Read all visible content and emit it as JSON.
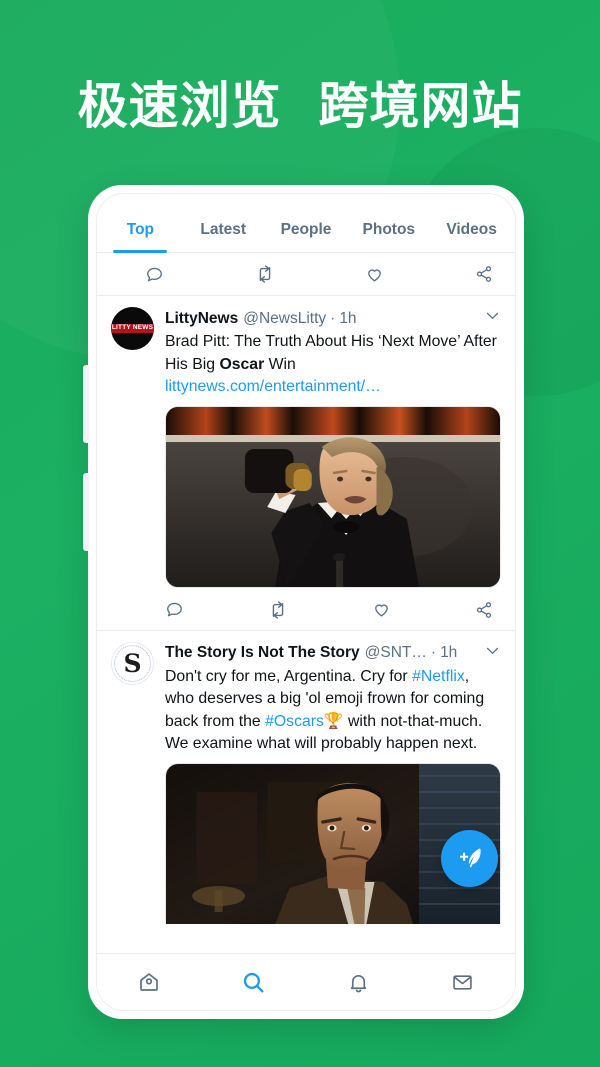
{
  "headline": "极速浏览  跨境网站",
  "theme": {
    "background_green": "#1bb062",
    "accent_blue": "#1d9bf0",
    "text_dark": "#0f1419",
    "text_muted": "#5b7083"
  },
  "phone": {
    "tabs": [
      {
        "label": "Top",
        "active": true
      },
      {
        "label": "Latest",
        "active": false
      },
      {
        "label": "People",
        "active": false
      },
      {
        "label": "Photos",
        "active": false
      },
      {
        "label": "Videos",
        "active": false
      }
    ],
    "top_actions": [
      {
        "icon": "reply-icon"
      },
      {
        "icon": "retweet-icon"
      },
      {
        "icon": "like-icon"
      },
      {
        "icon": "share-icon"
      }
    ],
    "tweets": [
      {
        "avatar_text": "LITTY NEWS",
        "name": "LittyNews",
        "handle": "@NewsLitty",
        "dot": "·",
        "time": "1h",
        "text_part1": "Brad Pitt: The Truth About His ‘Next Move’ After His Big ",
        "text_bold": "Oscar",
        "text_part2": " Win",
        "link": "littynews.com/entertainment/…",
        "media_alt": "Man in tuxedo holding award on stage",
        "actions": [
          {
            "icon": "reply-icon"
          },
          {
            "icon": "retweet-icon"
          },
          {
            "icon": "like-icon"
          },
          {
            "icon": "share-icon"
          }
        ]
      },
      {
        "avatar_text": "S",
        "name": "The Story Is Not The Story",
        "handle": "@SNT…",
        "dot": "·",
        "time": "1h",
        "text_part1": "Don't cry for me, Argentina. Cry for ",
        "tag1": "#Netflix",
        "text_part2": ", who deserves a big 'ol emoji frown for coming back from the ",
        "tag2": "#Oscars",
        "emoji": "🏆",
        "text_part3": " with not-that-much. We examine what will probably happen next.",
        "media_alt": "Film still of man in suit in dark room"
      }
    ],
    "fab": {
      "icon": "compose-feather-icon",
      "label": "Compose"
    },
    "bottom_nav": [
      {
        "icon": "home-icon",
        "label": "Home",
        "active": false
      },
      {
        "icon": "search-icon",
        "label": "Search",
        "active": true
      },
      {
        "icon": "bell-icon",
        "label": "Notifications",
        "active": false
      },
      {
        "icon": "mail-icon",
        "label": "Messages",
        "active": false
      }
    ]
  }
}
